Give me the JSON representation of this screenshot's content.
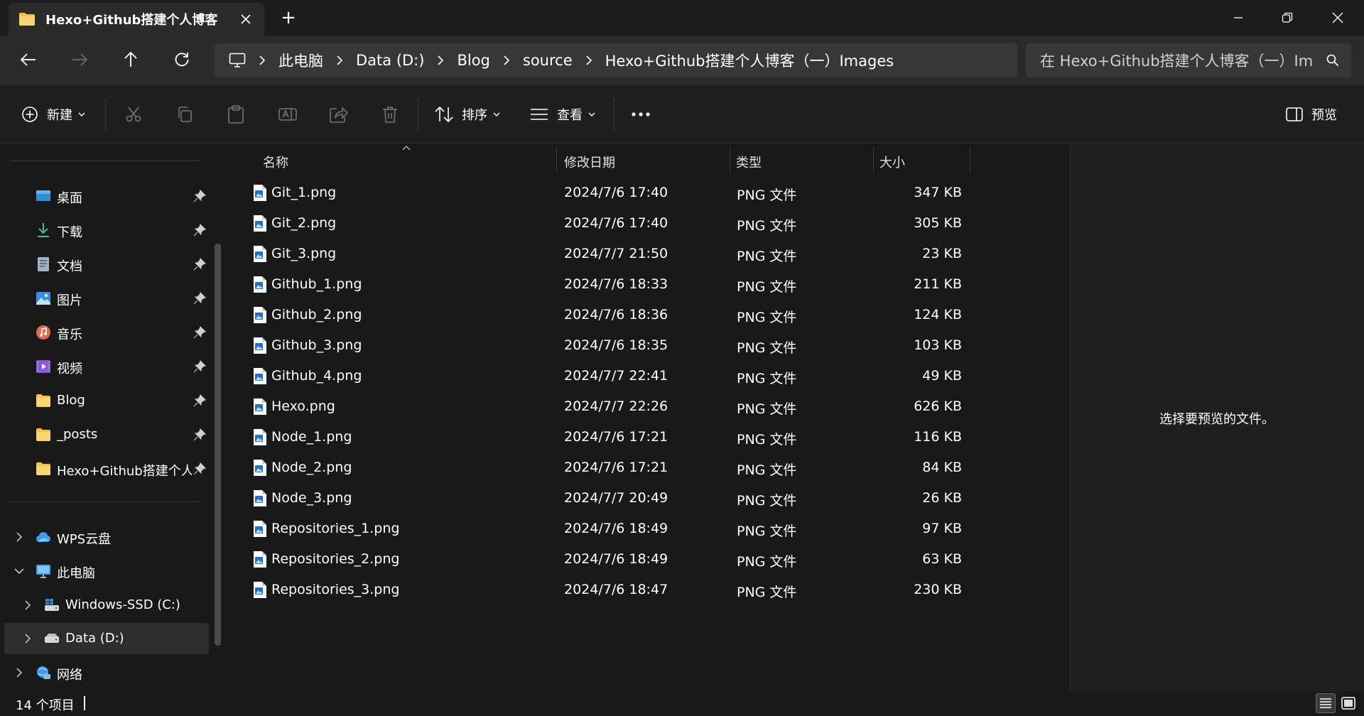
{
  "window": {
    "tab_title": "Hexo+Github搭建个人博客（一",
    "new_tab_glyph": "+"
  },
  "address": {
    "crumbs": [
      "此电脑",
      "Data (D:)",
      "Blog",
      "source",
      "Hexo+Github搭建个人博客（一）Images"
    ],
    "search_placeholder": "在 Hexo+Github搭建个人博客（一）Images 中搜索"
  },
  "toolbar": {
    "new_label": "新建",
    "sort_label": "排序",
    "view_label": "查看",
    "preview_label": "预览"
  },
  "sidebar": {
    "quick_access": [
      {
        "label": "桌面",
        "icon": "desktop-icon"
      },
      {
        "label": "下载",
        "icon": "download-icon"
      },
      {
        "label": "文档",
        "icon": "document-icon"
      },
      {
        "label": "图片",
        "icon": "pictures-icon"
      },
      {
        "label": "音乐",
        "icon": "music-icon"
      },
      {
        "label": "视频",
        "icon": "video-icon"
      },
      {
        "label": "Blog",
        "icon": "folder-icon"
      },
      {
        "label": "_posts",
        "icon": "folder-icon"
      },
      {
        "label": "Hexo+Github搭建个人博客（一）Images",
        "icon": "folder-icon"
      }
    ],
    "tree": [
      {
        "label": "WPS云盘",
        "icon": "cloud-icon",
        "expanded": false
      },
      {
        "label": "此电脑",
        "icon": "pc-icon",
        "expanded": true
      },
      {
        "label": "Windows-SSD (C:)",
        "icon": "drive-icon",
        "expanded": false
      },
      {
        "label": "Data (D:)",
        "icon": "drive-icon",
        "expanded": false,
        "selected": true
      },
      {
        "label": "网络",
        "icon": "network-icon",
        "expanded": false
      }
    ]
  },
  "columns": {
    "name": "名称",
    "date": "修改日期",
    "type": "类型",
    "size": "大小"
  },
  "files": [
    {
      "name": "Git_1.png",
      "date": "2024/7/6 17:40",
      "type": "PNG 文件",
      "size": "347 KB"
    },
    {
      "name": "Git_2.png",
      "date": "2024/7/6 17:40",
      "type": "PNG 文件",
      "size": "305 KB"
    },
    {
      "name": "Git_3.png",
      "date": "2024/7/7 21:50",
      "type": "PNG 文件",
      "size": "23 KB"
    },
    {
      "name": "Github_1.png",
      "date": "2024/7/6 18:33",
      "type": "PNG 文件",
      "size": "211 KB"
    },
    {
      "name": "Github_2.png",
      "date": "2024/7/6 18:36",
      "type": "PNG 文件",
      "size": "124 KB"
    },
    {
      "name": "Github_3.png",
      "date": "2024/7/6 18:35",
      "type": "PNG 文件",
      "size": "103 KB"
    },
    {
      "name": "Github_4.png",
      "date": "2024/7/7 22:41",
      "type": "PNG 文件",
      "size": "49 KB"
    },
    {
      "name": "Hexo.png",
      "date": "2024/7/7 22:26",
      "type": "PNG 文件",
      "size": "626 KB"
    },
    {
      "name": "Node_1.png",
      "date": "2024/7/6 17:21",
      "type": "PNG 文件",
      "size": "116 KB"
    },
    {
      "name": "Node_2.png",
      "date": "2024/7/6 17:21",
      "type": "PNG 文件",
      "size": "84 KB"
    },
    {
      "name": "Node_3.png",
      "date": "2024/7/7 20:49",
      "type": "PNG 文件",
      "size": "26 KB"
    },
    {
      "name": "Repositories_1.png",
      "date": "2024/7/6 18:49",
      "type": "PNG 文件",
      "size": "97 KB"
    },
    {
      "name": "Repositories_2.png",
      "date": "2024/7/6 18:49",
      "type": "PNG 文件",
      "size": "63 KB"
    },
    {
      "name": "Repositories_3.png",
      "date": "2024/7/6 18:47",
      "type": "PNG 文件",
      "size": "230 KB"
    }
  ],
  "preview": {
    "empty_text": "选择要预览的文件。"
  },
  "status": {
    "item_count": "14 个项目"
  },
  "colors": {
    "background": "#191919",
    "toolbar": "#1f1f1f",
    "addressbar": "#373737",
    "folder": "#f5c342",
    "selected": "#2d2d2d"
  }
}
